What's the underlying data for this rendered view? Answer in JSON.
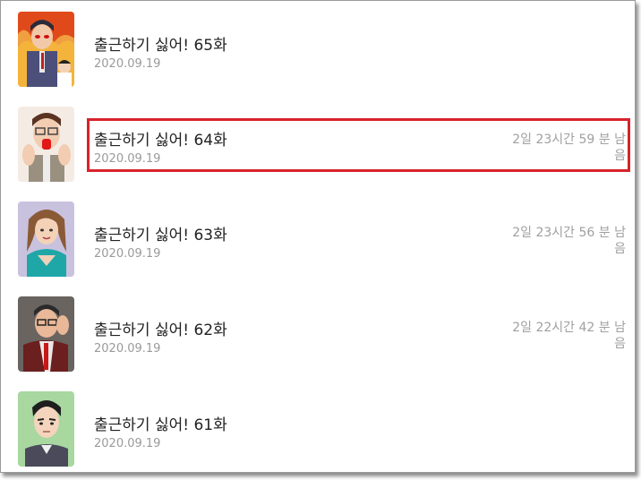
{
  "episodes": [
    {
      "title": "출근하기 싫어! 65화",
      "date": "2020.09.19",
      "remaining": ""
    },
    {
      "title": "출근하기 싫어! 64화",
      "date": "2020.09.19",
      "remaining": "2일 23시간 59 분 남음"
    },
    {
      "title": "출근하기 싫어! 63화",
      "date": "2020.09.19",
      "remaining": "2일 23시간 56 분 남음"
    },
    {
      "title": "출근하기 싫어! 62화",
      "date": "2020.09.19",
      "remaining": "2일 22시간 42 분 남음"
    },
    {
      "title": "출근하기 싫어! 61화",
      "date": "2020.09.19",
      "remaining": ""
    }
  ],
  "colors": {
    "highlight": "#d7232c",
    "date": "#9a9a9a",
    "title": "#222222"
  }
}
